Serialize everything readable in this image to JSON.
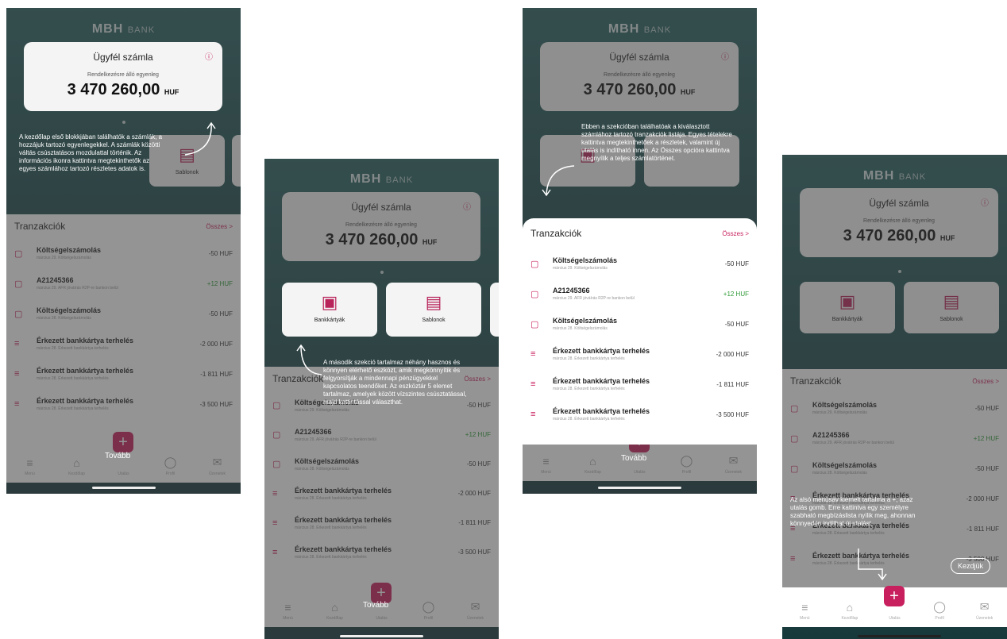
{
  "brand": {
    "logo": "MBH",
    "bank": "BANK"
  },
  "account": {
    "name": "Ügyfél számla",
    "available_label": "Rendelkezésre álló egyenleg",
    "balance": "3 470 260,00",
    "currency": "HUF",
    "info_icon": "ⓘ"
  },
  "tiles": [
    {
      "label": "Bankkártyák",
      "icon": "card-icon"
    },
    {
      "label": "Sablonok",
      "icon": "template-icon"
    }
  ],
  "transactions": {
    "title": "Tranzakciók",
    "all": "Összes",
    "all_arrow": ">",
    "items": [
      {
        "title": "Költségelszámolás",
        "date": "március 29. Költségelszámolás",
        "amount": "-50 HUF",
        "positive": false
      },
      {
        "title": "A21245366",
        "date": "március 29. AFR jóváírás R2P-re bankon belül",
        "amount": "+12 HUF",
        "positive": true
      },
      {
        "title": "Költségelszámolás",
        "date": "március 28. Költségelszámolás",
        "amount": "-50 HUF",
        "positive": false
      },
      {
        "title": "Érkezett bankkártya terhelés",
        "date": "március 28. Érkezett bankkártya terhelés",
        "amount": "-2 000 HUF",
        "positive": false
      },
      {
        "title": "Érkezett bankkártya terhelés",
        "date": "március 28. Érkezett bankkártya terhelés",
        "amount": "-1 811 HUF",
        "positive": false
      },
      {
        "title": "Érkezett bankkártya terhelés",
        "date": "március 28. Érkezett bankkártya terhelés",
        "amount": "-3 500 HUF",
        "positive": false
      }
    ]
  },
  "nav": {
    "items": [
      "Menü",
      "Kezdőlap",
      "Utalás",
      "Profil",
      "Üzenetek"
    ],
    "fab": "+"
  },
  "onboarding": {
    "step1": "A kezdőlap első blokkjában találhatók a számlák, a hozzájuk tartozó egyenlegekkel. A számlák közötti váltás csúsztatásos mozdulattal történik. Az információs ikonra kattintva megtekinthetők az egyes számlához tartozó részletes adatok is.",
    "step2": "A második szekció tartalmaz néhány hasznos és könnyen elérhető eszközt, amik megkönnyítik és felgyorsítják a mindennapi pénzügyekkel kapcsolatos teendőket. Az eszköztár 5 elemet tartalmaz, amelyek között vízszintes csúsztatással, majd kattintással választhat.",
    "step3": "Ebben a szekcióban találhatóak a kiválasztott számlához tartozó tranzakciók listája. Egyes tételekre kattintva megtekinthetőek a részletek, valamint új utalás is indítható innen. Az Összes opcióra kattintva megnyílik a teljes számlatörténet.",
    "step4": "Az alsó menüsáv kiemelt tartalma a +, azaz utalás gomb. Erre kattintva egy személyre szabható megbízáslista nyílik meg, ahonnan könnyedén indíthat új utalást.",
    "next": "Tovább",
    "start": "Kezdjük"
  },
  "colors": {
    "accent": "#c8205e",
    "positive": "#2e9a36",
    "bg": "#1f4a4d"
  }
}
